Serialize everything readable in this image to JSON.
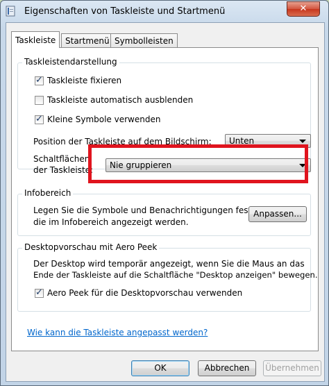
{
  "window": {
    "title": "Eigenschaften von Taskleiste und Startmenü",
    "close_glyph": "✕"
  },
  "tabs": [
    "Taskleiste",
    "Startmenü",
    "Symbolleisten"
  ],
  "taskbar_group": {
    "title": "Taskleistendarstellung",
    "lock": {
      "label": "Taskleiste fixieren",
      "checked": true
    },
    "autohide": {
      "label": "Taskleiste automatisch ausblenden",
      "checked": false
    },
    "small_icons": {
      "label": "Kleine Symbole verwenden",
      "checked": true
    },
    "position_label": "Position der Taskleiste auf dem Bildschirm:",
    "position_value": "Unten",
    "buttons_label_line1": "Schaltflächen",
    "buttons_label_line2": "der Taskleiste:",
    "buttons_value": "Nie gruppieren"
  },
  "notification_group": {
    "title": "Infobereich",
    "text_line1": "Legen Sie die Symbole und Benachrichtigungen fest,",
    "text_line2": "die im Infobereich angezeigt werden.",
    "customize_label": "Anpassen..."
  },
  "peek_group": {
    "title": "Desktopvorschau mit Aero Peek",
    "text_line1": "Der Desktop wird temporär angezeigt, wenn Sie die Maus an das",
    "text_line2": "Ende der Taskleiste auf die Schaltfläche \"Desktop anzeigen\" bewegen.",
    "peek": {
      "label": "Aero Peek für die Desktopvorschau verwenden",
      "checked": true
    }
  },
  "help_link": "Wie kann die Taskleiste angepasst werden?",
  "footer": {
    "ok": "OK",
    "cancel": "Abbrechen",
    "apply": "Übernehmen"
  },
  "colors": {
    "highlight": "#e0141e",
    "link": "#0066cc"
  }
}
